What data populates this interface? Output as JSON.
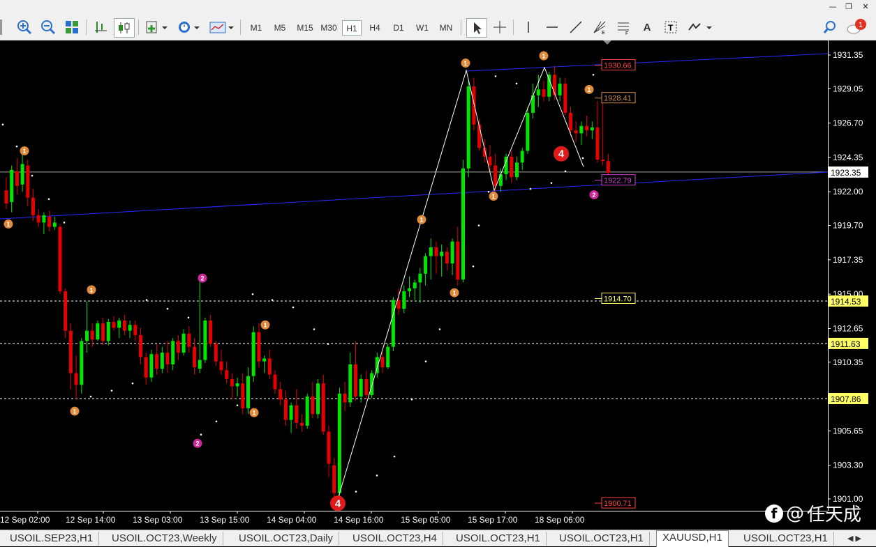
{
  "window": {
    "minimize_icon": "minimize-icon",
    "restore_icon": "restore-icon",
    "close_icon": "close-icon"
  },
  "toolbar": {
    "timeframes": [
      "M1",
      "M5",
      "M15",
      "M30",
      "H1",
      "H4",
      "D1",
      "W1",
      "MN"
    ],
    "active_timeframe": "H1",
    "tools": [
      "zoom-in-icon",
      "zoom-out-icon",
      "tile-windows-icon",
      "bar-chart-icon",
      "candlestick-icon",
      "indicators-icon",
      "periodicity-icon",
      "templates-icon",
      "cursor-icon",
      "crosshair-icon",
      "vertical-line-icon",
      "horizontal-line-icon",
      "trendline-icon",
      "gann-icon",
      "fibonacci-icon",
      "text-icon",
      "label-icon",
      "shapes-icon",
      "search-icon",
      "notification-icon"
    ],
    "notification_count": "1"
  },
  "chart": {
    "colors": {
      "background": "#000000",
      "bull": "#00e600",
      "bear": "#e60000",
      "grid": "#ffffff",
      "channel": "#2a2aff",
      "axis_text": "#ffffff"
    },
    "y_ticks": [
      "1931.35",
      "1929.05",
      "1926.70",
      "1924.35",
      "1922.00",
      "1919.70",
      "1917.35",
      "1915.00",
      "1912.65",
      "1910.35",
      "1908.00",
      "1905.65",
      "1903.30",
      "1901.00"
    ],
    "x_ticks": [
      "12 Sep 02:00",
      "12 Sep 14:00",
      "13 Sep 03:00",
      "13 Sep 15:00",
      "14 Sep 04:00",
      "14 Sep 16:00",
      "15 Sep 05:00",
      "15 Sep 17:00",
      "18 Sep 06:00"
    ],
    "current_price": "1923.35",
    "levels": [
      {
        "label": "1914.53",
        "value": 1914.53,
        "color": "#ffff66"
      },
      {
        "label": "1911.63",
        "value": 1911.63,
        "color": "#ffff66"
      },
      {
        "label": "1907.86",
        "value": 1907.86,
        "color": "#ffff66"
      }
    ],
    "price_labels": [
      {
        "text": "1930.66",
        "value": 1930.66,
        "color": "#ff4444",
        "bg": "#000"
      },
      {
        "text": "1928.41",
        "value": 1928.41,
        "color": "#d08a50",
        "bg": "#000"
      },
      {
        "text": "1922.79",
        "value": 1922.79,
        "color": "#cc44cc",
        "bg": "#000"
      },
      {
        "text": "1914.70",
        "value": 1914.7,
        "color": "#ffff66",
        "bg": "#000"
      },
      {
        "text": "1900.71",
        "value": 1900.71,
        "color": "#ff4444",
        "bg": "#000"
      }
    ],
    "markers": [
      {
        "text": "1",
        "kind": "orange"
      },
      {
        "text": "1",
        "kind": "orange"
      },
      {
        "text": "1",
        "kind": "orange"
      },
      {
        "text": "1",
        "kind": "orange"
      },
      {
        "text": "2",
        "kind": "magenta"
      },
      {
        "text": "2",
        "kind": "magenta"
      },
      {
        "text": "1",
        "kind": "orange"
      },
      {
        "text": "1",
        "kind": "orange"
      },
      {
        "text": "4",
        "kind": "red"
      },
      {
        "text": "1",
        "kind": "orange"
      },
      {
        "text": "1",
        "kind": "orange"
      },
      {
        "text": "1",
        "kind": "orange"
      },
      {
        "text": "1",
        "kind": "orange"
      },
      {
        "text": "4",
        "kind": "red"
      },
      {
        "text": "1",
        "kind": "orange"
      },
      {
        "text": "1",
        "kind": "orange"
      },
      {
        "text": "2",
        "kind": "magenta"
      }
    ]
  },
  "tabs": [
    "USOIL.SEP23,H1",
    "USOIL.OCT23,Weekly",
    "USOIL.OCT23,Daily",
    "USOIL.OCT23,H4",
    "USOIL.OCT23,H1",
    "USOIL.OCT23,H1",
    "XAUUSD,H1",
    "USOIL.OCT23,H1"
  ],
  "active_tab": "XAUUSD,H1",
  "watermark": {
    "symbol": "@",
    "name": "任天成"
  }
}
